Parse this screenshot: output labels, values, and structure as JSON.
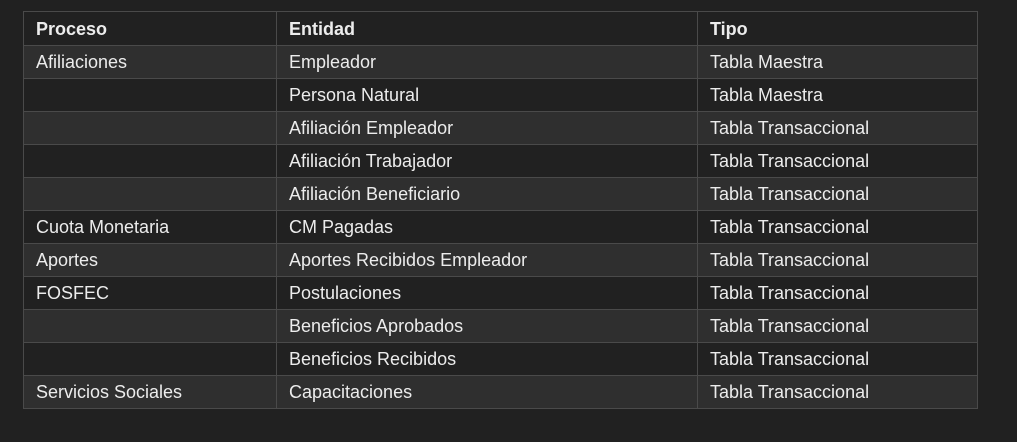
{
  "table": {
    "headers": [
      "Proceso",
      "Entidad",
      "Tipo"
    ],
    "rows": [
      [
        "Afiliaciones",
        "Empleador",
        "Tabla Maestra"
      ],
      [
        "",
        "Persona Natural",
        "Tabla Maestra"
      ],
      [
        "",
        "Afiliación Empleador",
        "Tabla Transaccional"
      ],
      [
        "",
        "Afiliación Trabajador",
        "Tabla Transaccional"
      ],
      [
        "",
        "Afiliación Beneficiario",
        "Tabla Transaccional"
      ],
      [
        "Cuota Monetaria",
        "CM Pagadas",
        "Tabla Transaccional"
      ],
      [
        "Aportes",
        "Aportes Recibidos Empleador",
        "Tabla Transaccional"
      ],
      [
        "FOSFEC",
        "Postulaciones",
        "Tabla Transaccional"
      ],
      [
        "",
        "Beneficios Aprobados",
        "Tabla Transaccional"
      ],
      [
        "",
        "Beneficios Recibidos",
        "Tabla Transaccional"
      ],
      [
        "Servicios Sociales",
        "Capacitaciones",
        "Tabla Transaccional"
      ]
    ]
  },
  "colors": {
    "background": "#212121",
    "row_alt": "#2f2f2f",
    "border": "#4a4a4a",
    "text": "#ececec"
  }
}
